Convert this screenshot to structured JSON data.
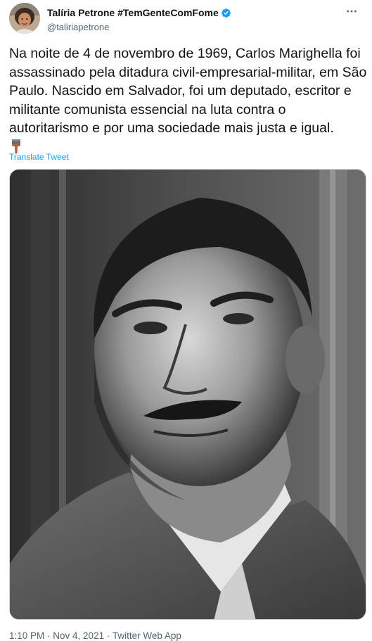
{
  "author": {
    "display_name": "Talíria Petrone #TemGenteComFome",
    "handle": "@taliriapetrone",
    "verified": true
  },
  "tweet": {
    "text": "Na noite de 4 de novembro de 1969, Carlos Marighella foi assassinado pela ditadura civil-empresarial-militar, em São Paulo. Nascido em Salvador, foi um deputado, escritor e militante comunista essencial na luta contra o autoritarismo e por uma sociedade mais justa e igual.",
    "emoji": "backhand-index-pointing-down",
    "translate_label": "Translate Tweet",
    "metadata": "1:10 PM · Nov 4, 2021 · Twitter Web App"
  },
  "icons": {
    "more": "more-options-icon",
    "verified": "verified-badge-icon"
  },
  "colors": {
    "link": "#1d9bf0",
    "text": "#0f1419",
    "secondary": "#536471",
    "verified": "#1d9bf0"
  }
}
